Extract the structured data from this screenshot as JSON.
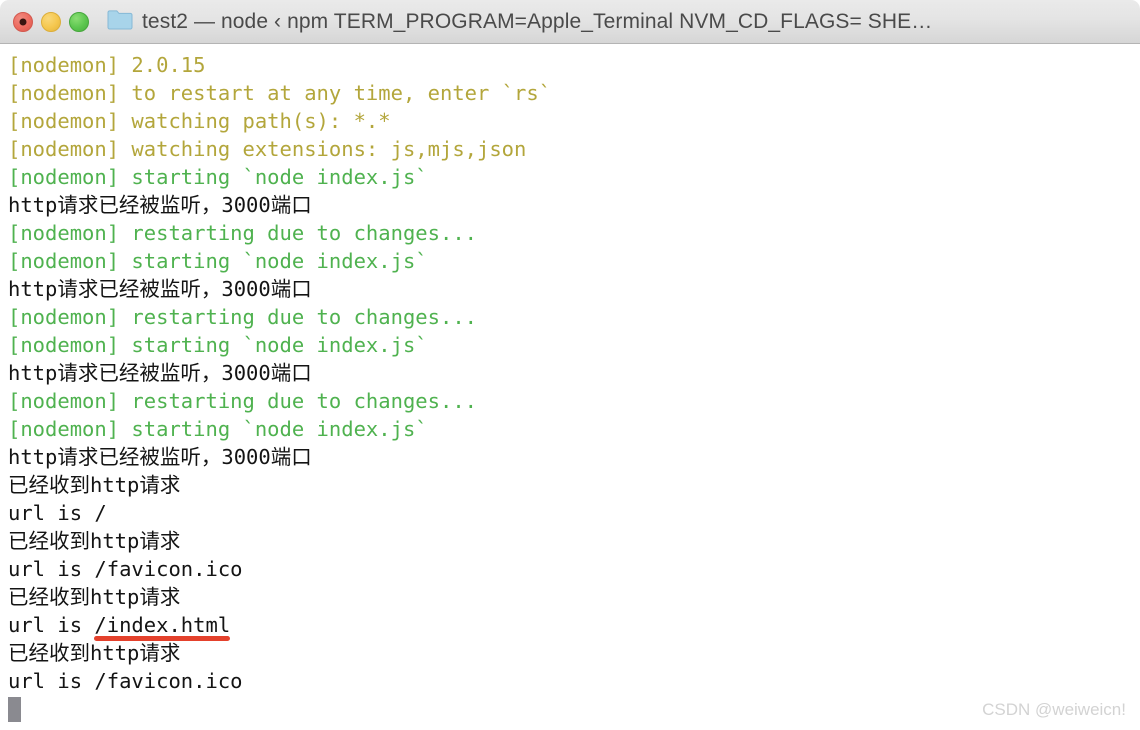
{
  "window": {
    "title": "test2 — node ‹ npm TERM_PROGRAM=Apple_Terminal NVM_CD_FLAGS= SHE…",
    "controls": {
      "close_label": "close",
      "minimize_label": "minimize",
      "maximize_label": "maximize"
    },
    "folder_icon": "folder-icon"
  },
  "terminal": {
    "lines": [
      {
        "color": "yellow",
        "text": "[nodemon] 2.0.15"
      },
      {
        "color": "yellow",
        "text": "[nodemon] to restart at any time, enter `rs`"
      },
      {
        "color": "yellow",
        "text": "[nodemon] watching path(s): *.*"
      },
      {
        "color": "yellow",
        "text": "[nodemon] watching extensions: js,mjs,json"
      },
      {
        "color": "green",
        "text": "[nodemon] starting `node index.js`"
      },
      {
        "color": "black",
        "text": "http请求已经被监听，3000端口"
      },
      {
        "color": "green",
        "text": "[nodemon] restarting due to changes..."
      },
      {
        "color": "green",
        "text": "[nodemon] starting `node index.js`"
      },
      {
        "color": "black",
        "text": "http请求已经被监听，3000端口"
      },
      {
        "color": "green",
        "text": "[nodemon] restarting due to changes..."
      },
      {
        "color": "green",
        "text": "[nodemon] starting `node index.js`"
      },
      {
        "color": "black",
        "text": "http请求已经被监听，3000端口"
      },
      {
        "color": "green",
        "text": "[nodemon] restarting due to changes..."
      },
      {
        "color": "green",
        "text": "[nodemon] starting `node index.js`"
      },
      {
        "color": "black",
        "text": "http请求已经被监听，3000端口"
      },
      {
        "color": "black",
        "text": "已经收到http请求"
      },
      {
        "color": "black",
        "text": "url is /"
      },
      {
        "color": "black",
        "text": "已经收到http请求"
      },
      {
        "color": "black",
        "text": "url is /favicon.ico"
      },
      {
        "color": "black",
        "text": "已经收到http请求"
      },
      {
        "color": "black",
        "text": "url is ",
        "highlight": "/index.html",
        "underline": true
      },
      {
        "color": "black",
        "text": "已经收到http请求"
      },
      {
        "color": "black",
        "text": "url is /favicon.ico"
      }
    ],
    "cursor": "block-cursor",
    "colors": {
      "yellow": "#b3a63b",
      "green": "#4fb24f",
      "black": "#141414",
      "underline": "#e4412c",
      "background": "#ffffff"
    }
  },
  "watermark": {
    "text": "CSDN @weiweicn!"
  }
}
